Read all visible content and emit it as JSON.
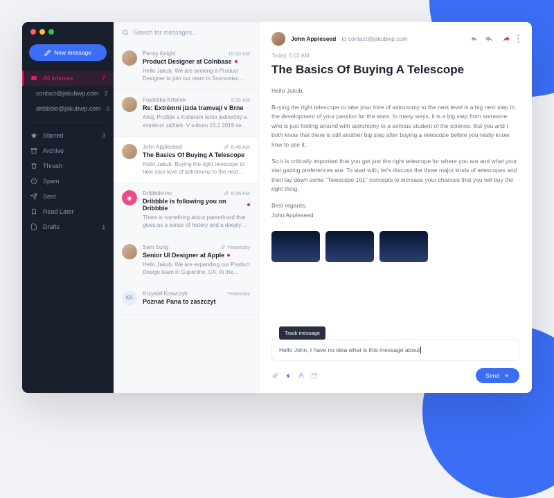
{
  "sidebar": {
    "new_message": "New message",
    "items": [
      {
        "icon": "inbox",
        "label": "All inboxes",
        "count": "7",
        "active": true
      },
      {
        "icon": "",
        "label": "contact@jakubwp.com",
        "count": "2"
      },
      {
        "icon": "",
        "label": "dribbble@jakubwp.com",
        "count": "5"
      }
    ],
    "folders": [
      {
        "icon": "star",
        "label": "Starred",
        "count": "3"
      },
      {
        "icon": "archive",
        "label": "Archive",
        "count": ""
      },
      {
        "icon": "trash",
        "label": "Thrash",
        "count": ""
      },
      {
        "icon": "spam",
        "label": "Spam",
        "count": ""
      },
      {
        "icon": "sent",
        "label": "Sent",
        "count": ""
      },
      {
        "icon": "later",
        "label": "Read Later",
        "count": ""
      },
      {
        "icon": "draft",
        "label": "Drafts",
        "count": "1"
      }
    ]
  },
  "search": {
    "placeholder": "Search for messages..."
  },
  "messages": [
    {
      "sender": "Penny Knight",
      "subject": "Product Designer at Coinbase",
      "preview": "Hello Jakub, We are seeking a Product Designer to join our team in Sosnowiec. We have just re...",
      "time": "10:10 AM",
      "unread": true,
      "attach": false
    },
    {
      "sender": "Františka Krteček",
      "subject": "Re: Extrémní jízda tramvají v Brne",
      "preview": "Ahoj, Prožijte s Kotlárem tento jedinečný a extrémní zážitek. V sobotu 10.2.2019 se ne...",
      "time": "9:32 AM",
      "unread": false,
      "bolt": true
    },
    {
      "sender": "John Appleseed",
      "subject": "The Basics Of Buying A Telescope",
      "preview": "Hello Jakub, Buying the right telescope to take your love of astronomy to the next level is a bi...",
      "time": "8:48 AM",
      "unread": false,
      "attach": true,
      "selected": true
    },
    {
      "sender": "Dribbble Inc",
      "subject": "Dribbble is following you on Dribbble",
      "preview": "There is something about parenthood that gives us a sense of history and a deeply roote...",
      "time": "8:36 AM",
      "unread": true,
      "attach": true,
      "pink": true
    },
    {
      "sender": "Sam Sung",
      "subject": "Senior UI Designer at Apple",
      "preview": "Hello Jakub, We are expanding our Product Design team in Cupertino, CA. At the mome...",
      "time": "Yesterday",
      "unread": true,
      "attach": true
    },
    {
      "sender": "Krzysief Krawczyk",
      "subject": "Poznać Pana to zaszczyt",
      "preview": "",
      "time": "Yesterday",
      "unread": false,
      "kk": true
    }
  ],
  "mail": {
    "from": "John Appleseed",
    "to_prefix": "to",
    "to": "contact@jakubwp.com",
    "date": "Today, 6:02 AM",
    "title": "The Basics Of Buying A Telescope",
    "greeting": "Hello Jakub,",
    "p1": "Buying the right telescope to take your love of astronomy to the next level is a big next step in the development of your passion for the stars. In many ways, it is a big step from someone who is just fooling around with astronomy to a serious student of the science. But you and I both know that there is still another big step after buying a telescope before you really know how to use it.",
    "p2": "So it is critically important that you get just the right telescope for where you are and what your star gazing preferences are. To start with, let's discuss the three major kinds of telescopes and then lay down some \"Telescope 101\" concepts to increase your chances that you will buy the right thing.",
    "signoff": "Best regards,",
    "signature": "John Appleseed"
  },
  "reply": {
    "text": "Hello John, I have no idea what is this message about",
    "tooltip": "Track message",
    "send": "Send"
  }
}
